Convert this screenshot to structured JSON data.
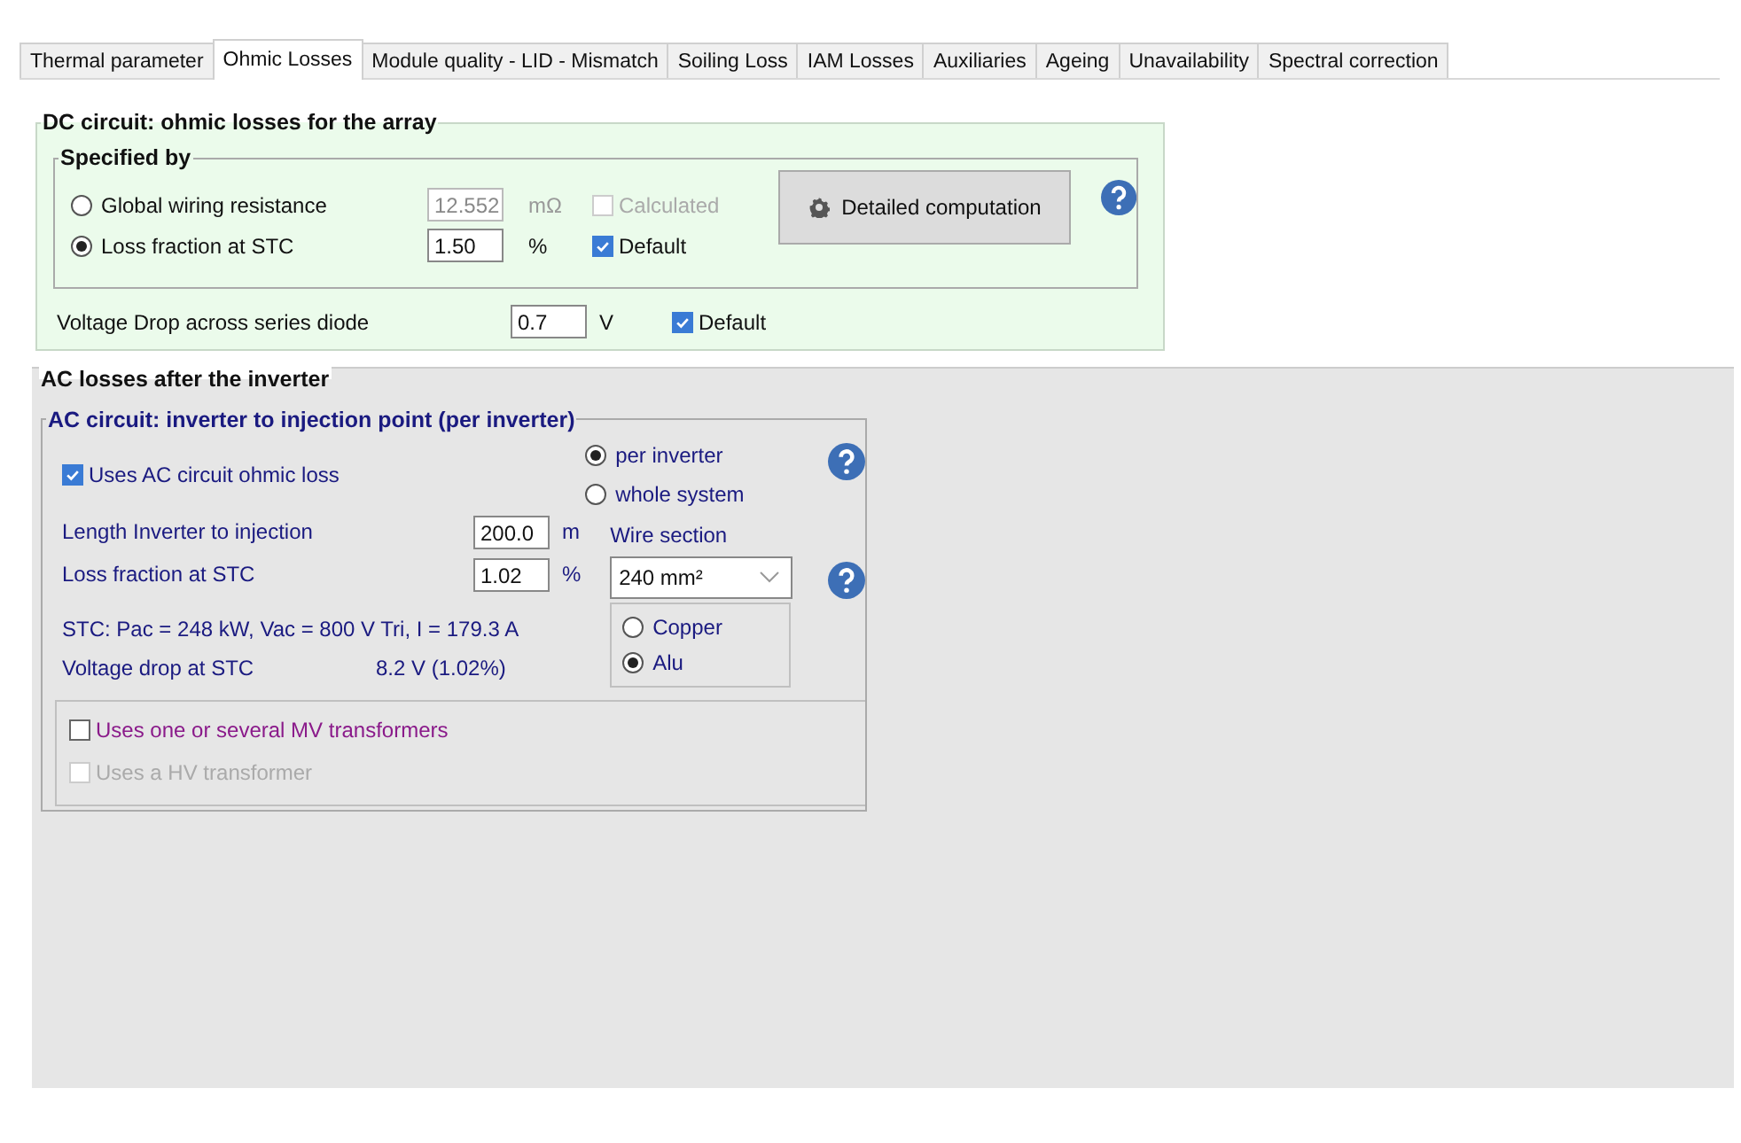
{
  "tabs": [
    {
      "label": "Thermal parameter",
      "selected": false
    },
    {
      "label": "Ohmic Losses",
      "selected": true
    },
    {
      "label": "Module quality - LID - Mismatch",
      "selected": false
    },
    {
      "label": "Soiling Loss",
      "selected": false
    },
    {
      "label": "IAM Losses",
      "selected": false
    },
    {
      "label": "Auxiliaries",
      "selected": false
    },
    {
      "label": "Ageing",
      "selected": false
    },
    {
      "label": "Unavailability",
      "selected": false
    },
    {
      "label": "Spectral correction",
      "selected": false
    }
  ],
  "dc": {
    "title": "DC circuit: ohmic losses for the array",
    "specified_by": {
      "title": "Specified by",
      "options": [
        {
          "label": "Global wiring resistance",
          "selected": false,
          "value": "12.552",
          "unit": "mΩ",
          "check": {
            "label": "Calculated",
            "checked": false
          }
        },
        {
          "label": "Loss fraction at STC",
          "selected": true,
          "value": "1.50",
          "unit": "%",
          "check": {
            "label": "Default",
            "checked": true
          }
        }
      ],
      "button": "Detailed computation"
    },
    "diode": {
      "label": "Voltage Drop across series diode",
      "value": "0.7",
      "unit": "V",
      "check": {
        "label": "Default",
        "checked": true
      }
    }
  },
  "ac": {
    "title": "AC losses after the inverter",
    "circuit": {
      "title": "AC circuit: inverter to injection point  (per inverter)",
      "uses": {
        "label": "Uses AC circuit ohmic loss",
        "checked": true
      },
      "scope": [
        {
          "label": "per inverter",
          "selected": true
        },
        {
          "label": "whole system",
          "selected": false
        }
      ],
      "length": {
        "label": "Length Inverter to injection",
        "value": "200.0",
        "unit": "m"
      },
      "wire_label": "Wire section",
      "loss": {
        "label": "Loss fraction at STC",
        "value": "1.02",
        "unit": "%"
      },
      "wire_section": "240 mm²",
      "stc": "STC: Pac = 248 kW,  Vac = 800 V Tri,  I = 179.3 A",
      "voltage_drop": {
        "label": "Voltage drop at STC",
        "value": "8.2 V  (1.02%)"
      },
      "materials": [
        {
          "label": "Copper",
          "selected": false
        },
        {
          "label": "Alu",
          "selected": true
        }
      ]
    },
    "transformers": [
      {
        "label": "Uses one or several MV transformers",
        "checked": false,
        "disabled": false
      },
      {
        "label": "Uses a HV transformer",
        "checked": false,
        "disabled": true
      }
    ]
  }
}
